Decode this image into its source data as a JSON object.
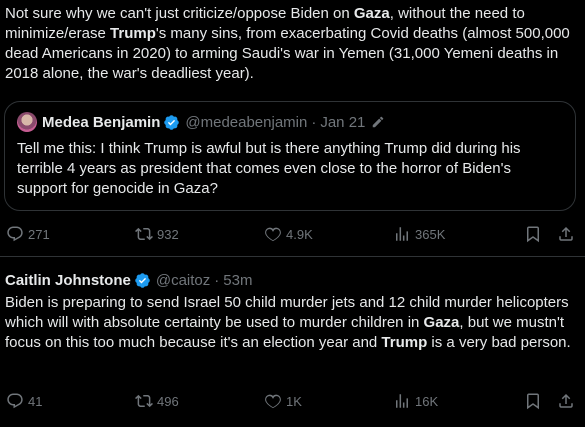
{
  "tweet1": {
    "text_parts": [
      {
        "t": "Not sure why we can't just criticize/oppose Biden on ",
        "b": false
      },
      {
        "t": "Gaza",
        "b": true
      },
      {
        "t": ", without the need to minimize/erase ",
        "b": false
      },
      {
        "t": "Trump",
        "b": true
      },
      {
        "t": "'s many sins, from exacerbating Covid deaths (almost 500,000 dead Americans in 2020) to arming Saudi's war in Yemen (31,000 Yemeni deaths in 2018 alone, the war's deadliest year).",
        "b": false
      }
    ],
    "quote": {
      "name": "Medea Benjamin",
      "handle": "@medeabenjamin",
      "separator": "·",
      "date": "Jan 21",
      "text": "Tell me this: I think Trump is awful but is there anything Trump did during his terrible 4 years as president that comes even close to the horror of Biden's support for genocide in Gaza?"
    },
    "actions": {
      "replies": "271",
      "reposts": "932",
      "likes": "4.9K",
      "views": "365K"
    }
  },
  "tweet2": {
    "name": "Caitlin Johnstone",
    "handle": "@caitoz",
    "separator": "·",
    "time": "53m",
    "text_parts": [
      {
        "t": "Biden is preparing to send Israel 50 child murder jets and 12 child murder helicopters which will with absolute certainty be used to murder children in ",
        "b": false
      },
      {
        "t": "Gaza",
        "b": true
      },
      {
        "t": ", but we mustn't focus on this too much because it's an election year and ",
        "b": false
      },
      {
        "t": "Trump",
        "b": true
      },
      {
        "t": " is a very bad person.",
        "b": false
      }
    ],
    "actions": {
      "replies": "41",
      "reposts": "496",
      "likes": "1K",
      "views": "16K"
    }
  },
  "colors": {
    "background": "#000000",
    "text": "#e7e9ea",
    "muted": "#71767b",
    "verified": "#1d9bf0",
    "border": "#2f3336"
  }
}
